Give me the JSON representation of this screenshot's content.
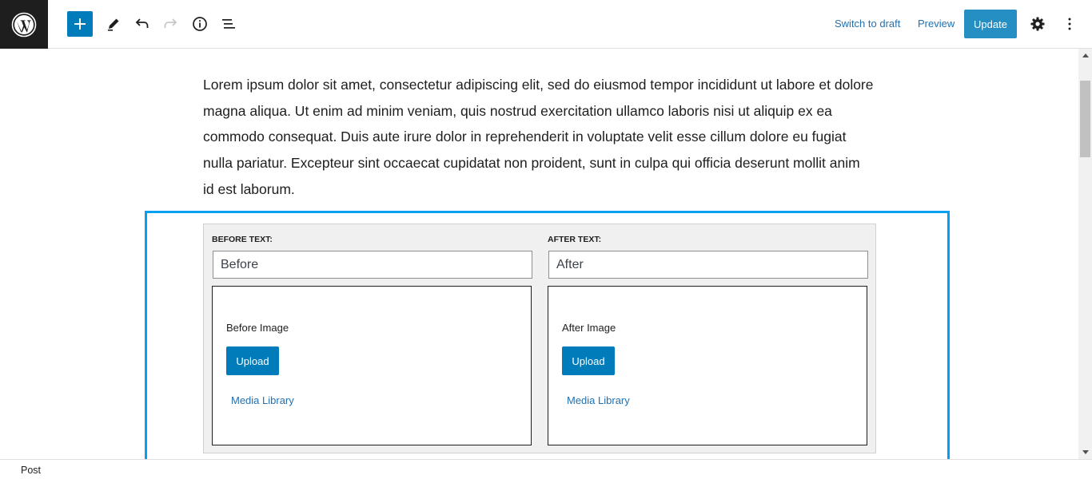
{
  "toolbar": {
    "switch_to_draft": "Switch to draft",
    "preview": "Preview",
    "update": "Update",
    "icons": [
      "wordpress-logo",
      "plus-icon",
      "pencil-icon",
      "undo-icon",
      "redo-icon",
      "info-icon",
      "list-view-icon",
      "gear-icon",
      "more-vertical-icon"
    ]
  },
  "content": {
    "paragraph": "Lorem ipsum dolor sit amet, consectetur adipiscing elit, sed do eiusmod tempor incididunt ut labore et dolore magna aliqua. Ut enim ad minim veniam, quis nostrud exercitation ullamco laboris nisi ut aliquip ex ea commodo consequat. Duis aute irure dolor in reprehenderit in voluptate velit esse cillum dolore eu fugiat nulla pariatur. Excepteur sint occaecat cupidatat non proident, sunt in culpa qui officia deserunt mollit anim id est laborum."
  },
  "before_after": {
    "before": {
      "label": "BEFORE TEXT:",
      "value": "Before",
      "image_title": "Before Image",
      "upload": "Upload",
      "media_library": "Media Library"
    },
    "after": {
      "label": "AFTER TEXT:",
      "value": "After",
      "image_title": "After Image",
      "upload": "Upload",
      "media_library": "Media Library"
    }
  },
  "footer": {
    "breadcrumb": "Post"
  },
  "colors": {
    "accent": "#007cba",
    "link": "#2271b1",
    "selection": "#00a0f3",
    "dark": "#1e1e1e"
  }
}
